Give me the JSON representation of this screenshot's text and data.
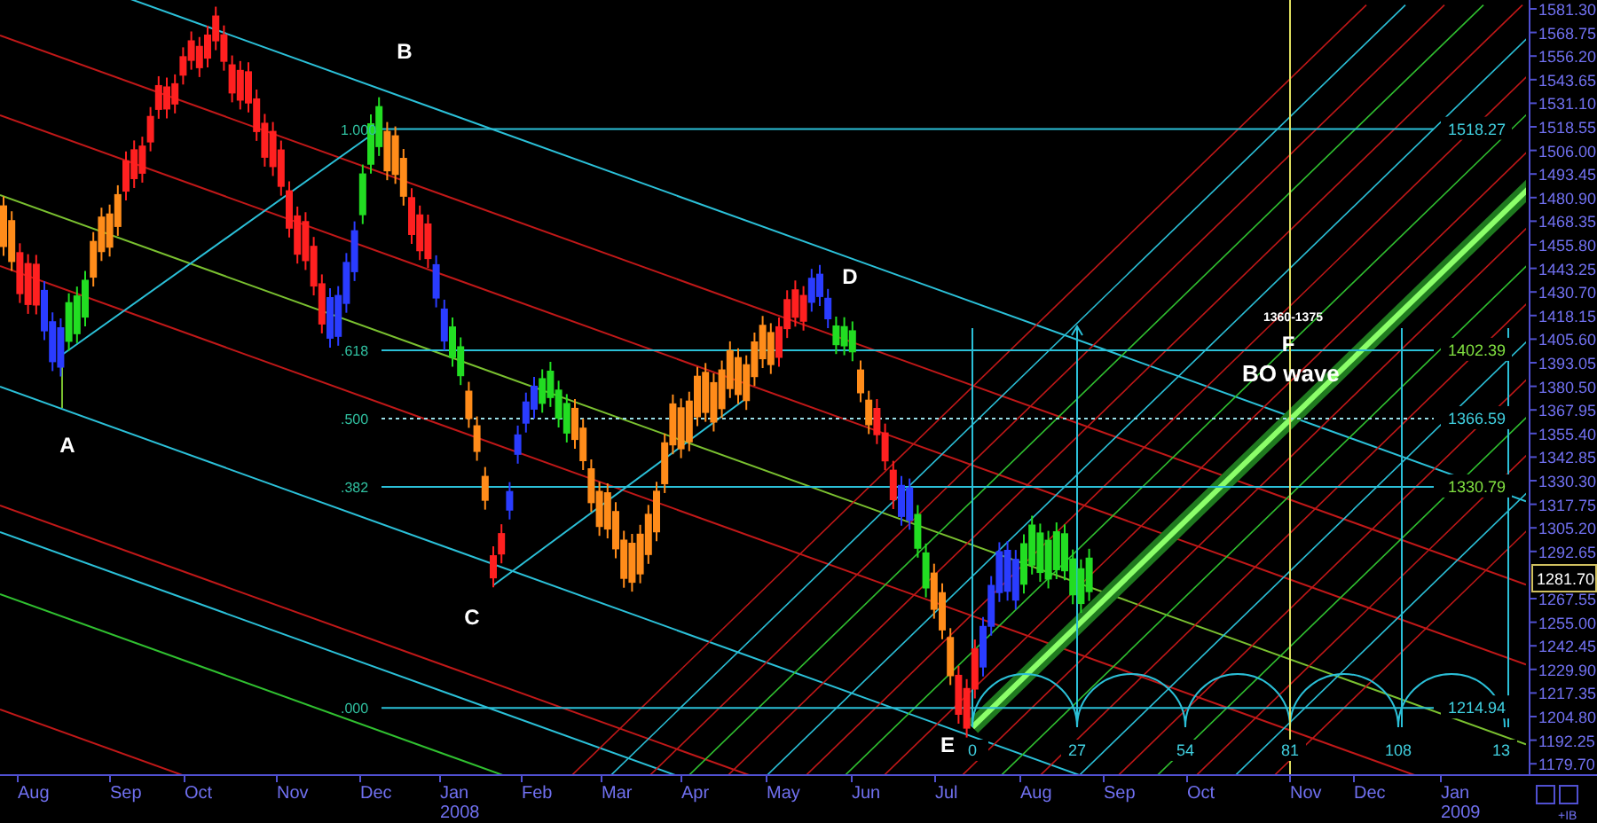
{
  "price_axis": {
    "labels": [
      "1581.30",
      "1568.75",
      "1556.20",
      "1543.65",
      "1531.10",
      "1518.55",
      "1506.00",
      "1493.45",
      "1480.90",
      "1468.35",
      "1455.80",
      "1443.25",
      "1430.70",
      "1418.15",
      "1405.60",
      "1393.05",
      "1380.50",
      "1367.95",
      "1355.40",
      "1342.85",
      "1330.30",
      "1317.75",
      "1305.20",
      "1292.65",
      "1267.55",
      "1255.00",
      "1242.45",
      "1229.90",
      "1217.35",
      "1204.80",
      "1192.25",
      "1179.70"
    ]
  },
  "time_axis": {
    "labels": [
      {
        "month": "Aug"
      },
      {
        "month": "Sep"
      },
      {
        "month": "Oct"
      },
      {
        "month": "Nov"
      },
      {
        "month": "Dec"
      },
      {
        "month": "Jan",
        "year": "2008"
      },
      {
        "month": "Feb"
      },
      {
        "month": "Mar"
      },
      {
        "month": "Apr"
      },
      {
        "month": "May"
      },
      {
        "month": "Jun"
      },
      {
        "month": "Jul"
      },
      {
        "month": "Aug"
      },
      {
        "month": "Sep"
      },
      {
        "month": "Oct"
      },
      {
        "month": "Nov"
      },
      {
        "month": "Dec"
      },
      {
        "month": "Jan",
        "year": "2009"
      }
    ]
  },
  "current_price": "1281.70",
  "points": [
    {
      "label": "A"
    },
    {
      "label": "B"
    },
    {
      "label": "C"
    },
    {
      "label": "D"
    },
    {
      "label": "E"
    },
    {
      "label": "F"
    }
  ],
  "fib_levels": [
    {
      "ratio": "1.000",
      "price": "1518.27"
    },
    {
      "ratio": ".618",
      "price": "1402.39"
    },
    {
      "ratio": ".500",
      "price": "1366.59"
    },
    {
      "ratio": ".382",
      "price": "1330.79"
    },
    {
      "ratio": ".000",
      "price": "1214.94"
    }
  ],
  "cycle_labels": [
    "0",
    "27",
    "54",
    "81",
    "108",
    "13"
  ],
  "target": "1360-1375",
  "wave_label": "BO wave",
  "corner_label": "+IB"
}
